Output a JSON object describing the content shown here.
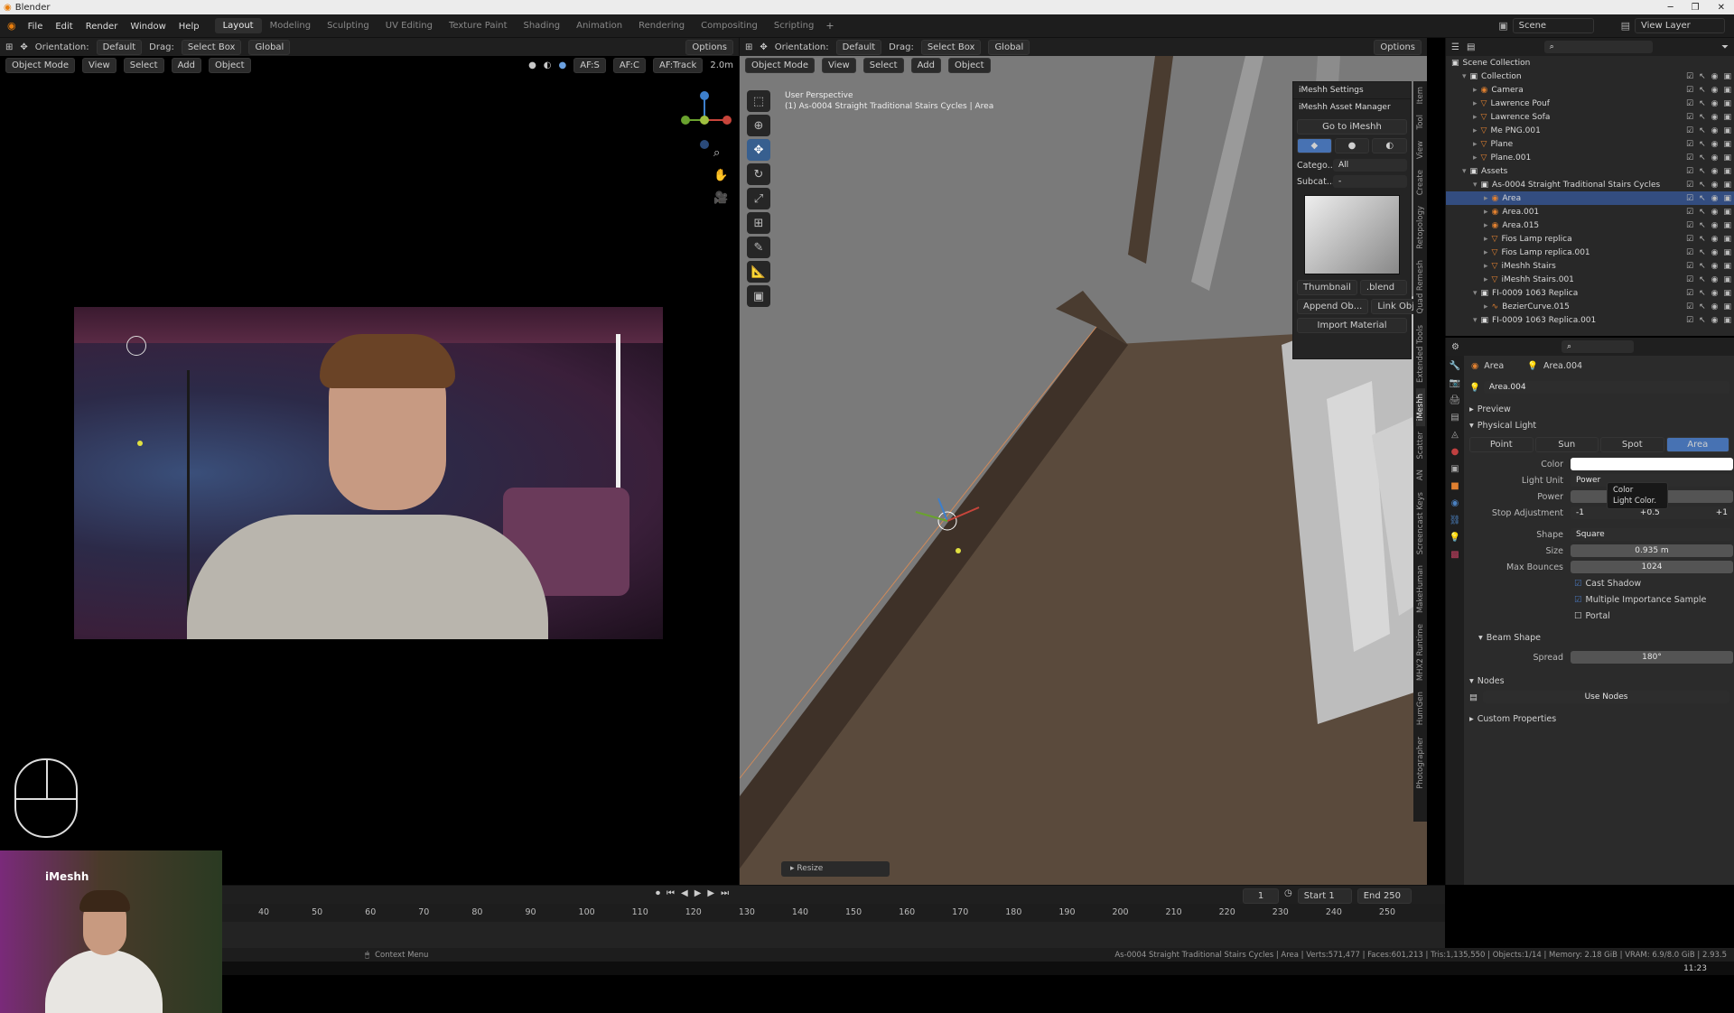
{
  "window": {
    "title": "Blender"
  },
  "menu": [
    "File",
    "Edit",
    "Render",
    "Window",
    "Help"
  ],
  "workspaces": [
    {
      "label": "Layout",
      "active": true
    },
    {
      "label": "Modeling"
    },
    {
      "label": "Sculpting"
    },
    {
      "label": "UV Editing"
    },
    {
      "label": "Texture Paint"
    },
    {
      "label": "Shading"
    },
    {
      "label": "Animation"
    },
    {
      "label": "Rendering"
    },
    {
      "label": "Compositing"
    },
    {
      "label": "Scripting"
    }
  ],
  "scene": {
    "name": "Scene",
    "view_layer": "View Layer"
  },
  "left_viewport": {
    "header": {
      "orientation_label": "Orientation:",
      "orientation": "Default",
      "drag_label": "Drag:",
      "drag": "Select Box",
      "transform": "Global",
      "options": "Options"
    },
    "subheader": {
      "mode": "Object Mode",
      "view": "View",
      "select": "Select",
      "add": "Add",
      "object": "Object",
      "af_s": "AF:S",
      "af_c": "AF:C",
      "af_track": "AF:Track",
      "distance": "2.0m"
    }
  },
  "webcam": {
    "label": "iMeshh"
  },
  "right_viewport": {
    "header": {
      "orientation_label": "Orientation:",
      "orientation": "Default",
      "drag_label": "Drag:",
      "drag": "Select Box",
      "transform": "Global",
      "options": "Options"
    },
    "subheader": {
      "mode": "Object Mode",
      "view": "View",
      "select": "Select",
      "add": "Add",
      "object": "Object"
    },
    "overlay_text": {
      "line1": "User Perspective",
      "line2": "(1) As-0004 Straight Traditional Stairs Cycles | Area"
    },
    "operator_panel": "Resize"
  },
  "imeshh": {
    "settings": "iMeshh Settings",
    "asset_manager": "iMeshh Asset Manager",
    "goto": "Go to iMeshh",
    "category_label": "Catego...",
    "category": "All",
    "subcategory_label": "Subcat...",
    "subcategory": "-",
    "thumbnail_btn": "Thumbnail",
    "blend_btn": ".blend",
    "append_btn": "Append Ob...",
    "link_btn": "Link Object",
    "import_btn": "Import Material"
  },
  "sidebar_tabs_right": [
    "Item",
    "Tool",
    "View",
    "Create",
    "Retopology",
    "Quad Remesh",
    "Extended Tools",
    "iMeshh",
    "Scatter",
    "AN",
    "Screencast Keys",
    "MakeHuman",
    "MHX2 Runtime",
    "HumGen",
    "Photographer"
  ],
  "outliner": {
    "root": "Scene Collection",
    "items": [
      {
        "label": "Collection",
        "depth": 1,
        "type": "collection"
      },
      {
        "label": "Camera",
        "depth": 2,
        "type": "camera"
      },
      {
        "label": "Lawrence Pouf",
        "depth": 2,
        "type": "mesh"
      },
      {
        "label": "Lawrence Sofa",
        "depth": 2,
        "type": "mesh"
      },
      {
        "label": "Me PNG.001",
        "depth": 2,
        "type": "mesh"
      },
      {
        "label": "Plane",
        "depth": 2,
        "type": "mesh"
      },
      {
        "label": "Plane.001",
        "depth": 2,
        "type": "mesh"
      },
      {
        "label": "Assets",
        "depth": 1,
        "type": "collection"
      },
      {
        "label": "As-0004 Straight Traditional Stairs Cycles",
        "depth": 2,
        "type": "collection"
      },
      {
        "label": "Area",
        "depth": 3,
        "type": "light",
        "selected": true
      },
      {
        "label": "Area.001",
        "depth": 3,
        "type": "light"
      },
      {
        "label": "Area.015",
        "depth": 3,
        "type": "light"
      },
      {
        "label": "Fios Lamp replica",
        "depth": 3,
        "type": "mesh"
      },
      {
        "label": "Fios Lamp replica.001",
        "depth": 3,
        "type": "mesh"
      },
      {
        "label": "iMeshh Stairs",
        "depth": 3,
        "type": "mesh"
      },
      {
        "label": "iMeshh Stairs.001",
        "depth": 3,
        "type": "mesh"
      },
      {
        "label": "FI-0009 1063 Replica",
        "depth": 2,
        "type": "collection"
      },
      {
        "label": "BezierCurve.015",
        "depth": 3,
        "type": "curve"
      },
      {
        "label": "FI-0009 1063 Replica.001",
        "depth": 2,
        "type": "collection"
      }
    ]
  },
  "properties": {
    "object_name": "Area",
    "data_name": "Area.004",
    "datablock": "Area.004",
    "preview": "Preview",
    "physical_light": "Physical Light",
    "light_types": [
      "Point",
      "Sun",
      "Spot",
      "Area"
    ],
    "active_type": "Area",
    "color_label": "Color",
    "tooltip_title": "Color",
    "tooltip_desc": "Light Color.",
    "light_unit_label": "Light Unit",
    "light_unit": "Power",
    "power_label": "Power",
    "stop_label": "Stop Adjustment",
    "stop_minus": "-1",
    "stop_half": "+0.5",
    "stop_plus": "+1",
    "shape_label": "Shape",
    "shape": "Square",
    "size_label": "Size",
    "size": "0.935 m",
    "bounces_label": "Max Bounces",
    "bounces": "1024",
    "cast_shadow": "Cast Shadow",
    "mis": "Multiple Importance Sample",
    "portal": "Portal",
    "beam_shape": "Beam Shape",
    "spread_label": "Spread",
    "spread": "180°",
    "nodes": "Nodes",
    "use_nodes": "Use Nodes",
    "custom_props": "Custom Properties"
  },
  "timeline": {
    "current_frame": "1",
    "start_label": "Start",
    "start": "1",
    "end_label": "End",
    "end": "250",
    "ticks": [
      "40",
      "50",
      "60",
      "70",
      "80",
      "90",
      "100",
      "110",
      "120",
      "130",
      "140",
      "150",
      "160",
      "170",
      "180",
      "190",
      "200",
      "210",
      "220",
      "230",
      "240",
      "250"
    ]
  },
  "statusbar": {
    "context": "Context Menu",
    "stats": "As-0004 Straight Traditional Stairs Cycles | Area | Verts:571,477 | Faces:601,213 | Tris:1,135,550 | Objects:1/14 | Memory: 2.18 GiB | VRAM: 6.9/8.0 GiB | 2.93.5",
    "clock": "11:23"
  },
  "colors": {
    "accent": "#375f8f",
    "selected_row": "#334d80",
    "active_tab": "#4772b3"
  }
}
